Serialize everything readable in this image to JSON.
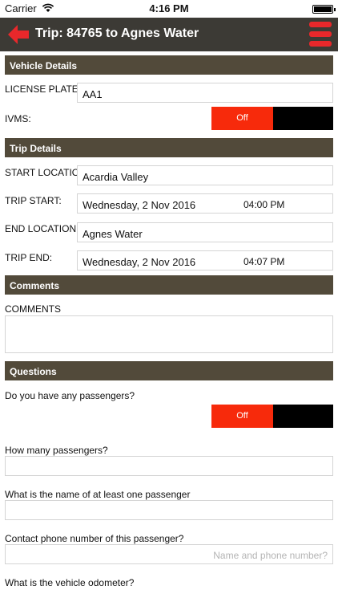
{
  "status_bar": {
    "carrier": "Carrier",
    "time": "4:16 PM"
  },
  "header": {
    "title": "Trip: 84765 to Agnes Water"
  },
  "sections": {
    "vehicle": "Vehicle Details",
    "trip": "Trip Details",
    "comments": "Comments",
    "questions": "Questions"
  },
  "vehicle": {
    "license_label": "LICENSE PLATE:",
    "license_value": "AA1",
    "ivms_label": "IVMS:",
    "ivms_toggle": "Off"
  },
  "trip": {
    "start_location_label": "START LOCATION:",
    "start_location_value": "Acardia Valley",
    "trip_start_label": "TRIP START:",
    "trip_start_date": "Wednesday, 2 Nov 2016",
    "trip_start_time": "04:00 PM",
    "end_location_label": "END LOCATION:",
    "end_location_value": "Agnes Water",
    "trip_end_label": "TRIP END:",
    "trip_end_date": "Wednesday, 2 Nov 2016",
    "trip_end_time": "04:07 PM"
  },
  "comments": {
    "label": "COMMENTS"
  },
  "questions": {
    "passengers_q": "Do you have any passengers?",
    "passengers_toggle": "Off",
    "how_many_q": "How many passengers?",
    "name_q": "What is the name of at least one passenger",
    "phone_q": "Contact phone number of this passenger?",
    "phone_placeholder": "Name and phone number?",
    "odometer_q": "What is the vehicle odometer?"
  },
  "colors": {
    "nav_bg": "#3c3a35",
    "section_bg": "#524a3a",
    "accent_red": "#e8282b",
    "toggle_off": "#f72a0b"
  },
  "icons": {
    "back": "back-arrow-icon",
    "menu": "hamburger-menu-icon",
    "wifi": "wifi-icon",
    "battery": "battery-icon"
  }
}
